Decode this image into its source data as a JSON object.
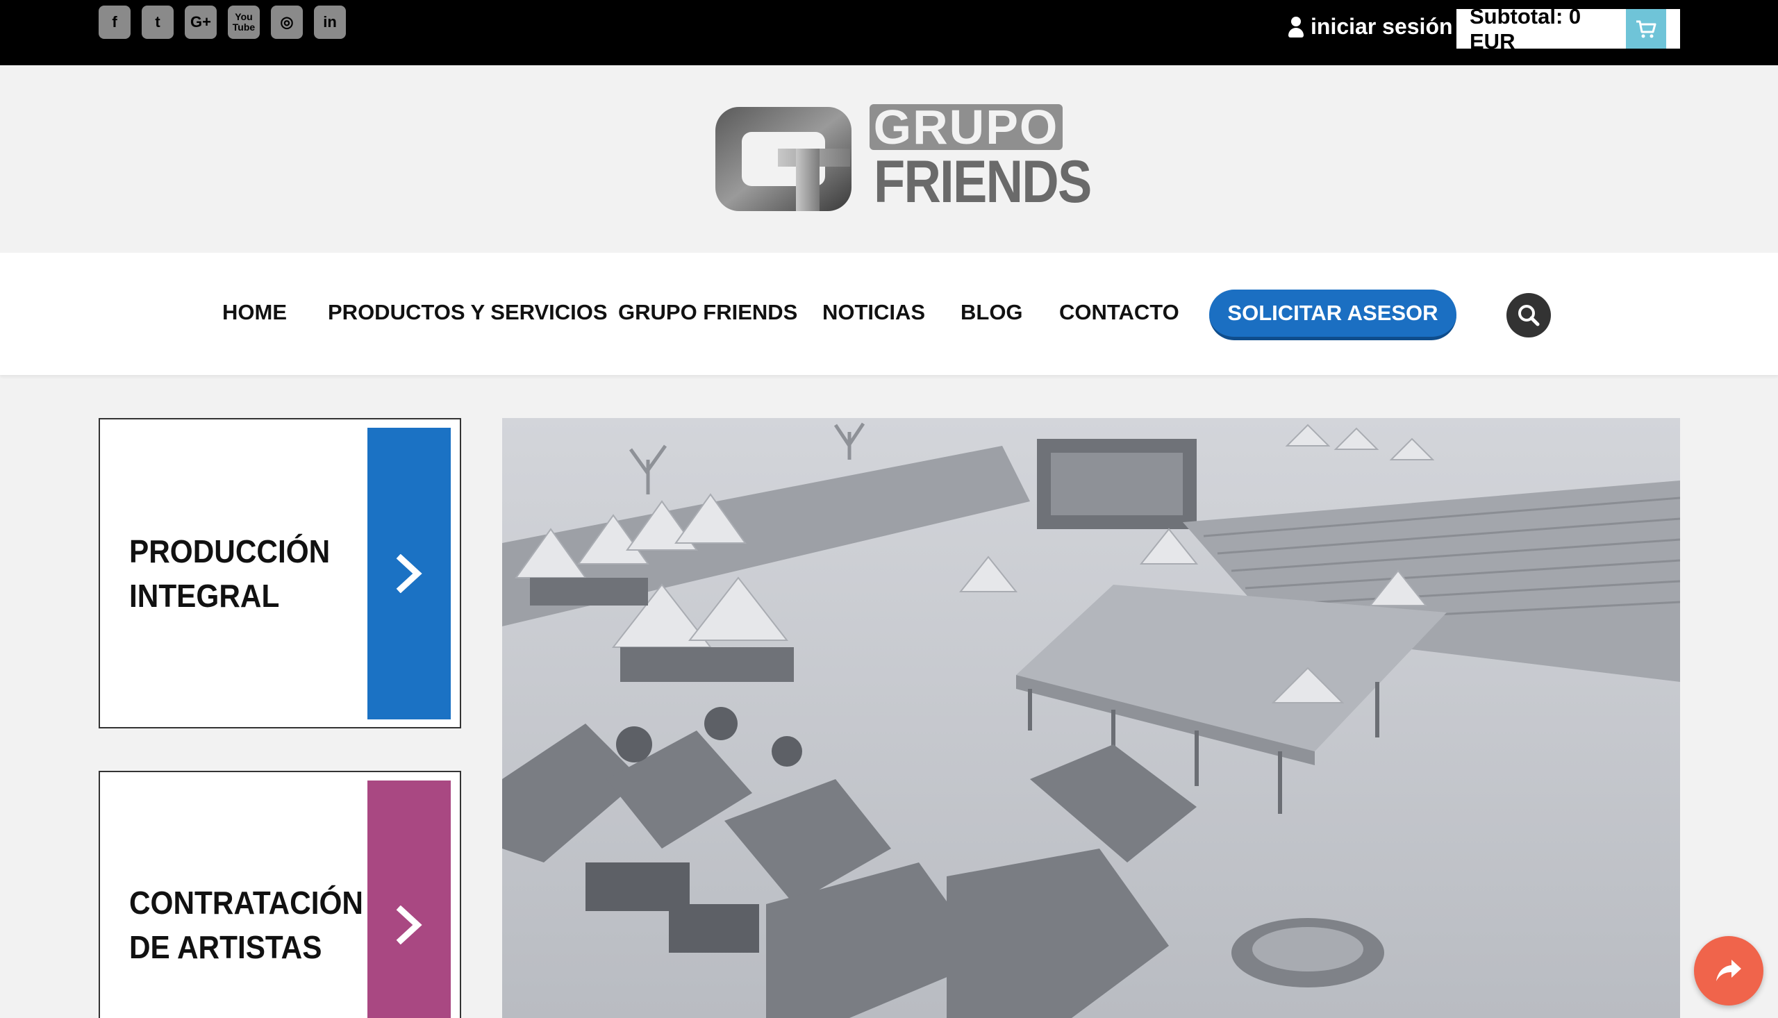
{
  "topbar": {
    "social": [
      {
        "icon": "facebook-icon",
        "glyph": "f"
      },
      {
        "icon": "twitter-icon",
        "glyph": "t"
      },
      {
        "icon": "google-plus-icon",
        "glyph": "G+"
      },
      {
        "icon": "youtube-icon",
        "glyph": "You\nTube"
      },
      {
        "icon": "instagram-icon",
        "glyph": "◎"
      },
      {
        "icon": "linkedin-icon",
        "glyph": "in"
      }
    ],
    "login_label": "iniciar sesión",
    "subtotal_label": "Subtotal: 0 EUR",
    "cart_icon": "cart-icon"
  },
  "logo": {
    "line1": "GRUPO",
    "line2": "FRIENDS"
  },
  "nav": {
    "items": [
      "HOME",
      "PRODUCTOS Y SERVICIOS",
      "GRUPO FRIENDS",
      "NOTICIAS",
      "BLOG",
      "CONTACTO"
    ],
    "cta_label": "SOLICITAR ASESOR",
    "search_icon": "search-icon"
  },
  "cards": [
    {
      "line1": "PRODUCCIÓN",
      "line2": "INTEGRAL",
      "color": "#1b72c4"
    },
    {
      "line1": "CONTRATACIÓN",
      "line2": "DE ARTISTAS",
      "color": "#a94882"
    }
  ],
  "colors": {
    "topbar": "#000000",
    "accent_blue": "#1b6fc2",
    "accent_magenta": "#a94882",
    "cart_accent": "#6fc4d8",
    "share_button": "#f0644b"
  },
  "hero": {
    "image_alt_icon": "event-venue-render-image"
  },
  "floating": {
    "share_icon": "share-icon"
  }
}
